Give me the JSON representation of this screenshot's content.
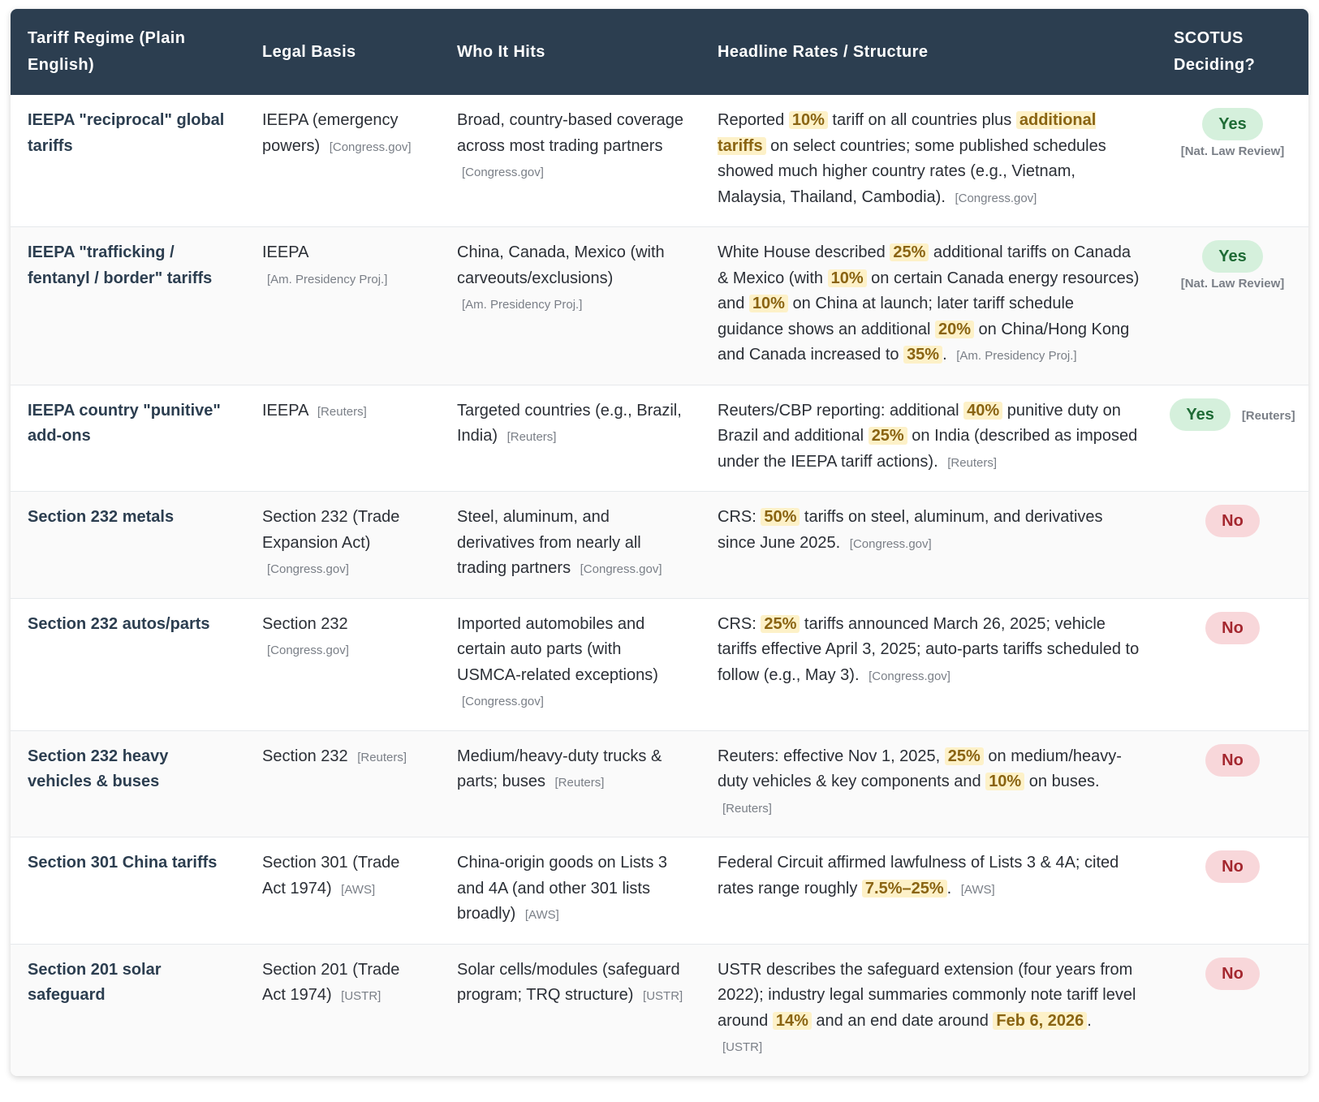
{
  "table": {
    "headers": [
      "Tariff Regime (Plain English)",
      "Legal Basis",
      "Who It Hits",
      "Headline Rates / Structure",
      "SCOTUS Deciding?"
    ],
    "rows": [
      {
        "regime": "IEEPA \"reciprocal\" global tariffs",
        "basis": "IEEPA (emergency powers)",
        "basis_cite": "[Congress.gov]",
        "hits": "Broad, country-based coverage across most trading partners",
        "hits_cite": "[Congress.gov]",
        "rates": [
          {
            "t": "Reported "
          },
          {
            "h": "10%"
          },
          {
            "t": " tariff on all countries plus "
          },
          {
            "h": "additional tariffs"
          },
          {
            "t": " on select countries; some published schedules showed much higher country rates (e.g., Vietnam, Malaysia, Thailand, Cambodia)."
          }
        ],
        "rates_cite": "[Congress.gov]",
        "scotus": "Yes",
        "scotus_cite": "[Nat. Law Review]"
      },
      {
        "regime": "IEEPA \"trafficking / fentanyl / border\" tariffs",
        "basis": "IEEPA",
        "basis_cite": "[Am. Presidency Proj.]",
        "hits": "China, Canada, Mexico (with carveouts/exclusions)",
        "hits_cite": "[Am. Presidency Proj.]",
        "rates": [
          {
            "t": "White House described "
          },
          {
            "h": "25%"
          },
          {
            "t": " additional tariffs on Canada & Mexico (with "
          },
          {
            "h": "10%"
          },
          {
            "t": " on certain Canada energy resources) and "
          },
          {
            "h": "10%"
          },
          {
            "t": " on China at launch; later tariff schedule guidance shows an additional "
          },
          {
            "h": "20%"
          },
          {
            "t": " on China/Hong Kong and Canada increased to "
          },
          {
            "h": "35%"
          },
          {
            "t": "."
          }
        ],
        "rates_cite": "[Am. Presidency Proj.]",
        "scotus": "Yes",
        "scotus_cite": "[Nat. Law Review]"
      },
      {
        "regime": "IEEPA country \"punitive\" add-ons",
        "basis": "IEEPA",
        "basis_cite": "[Reuters]",
        "hits": "Targeted countries (e.g., Brazil, India)",
        "hits_cite": "[Reuters]",
        "rates": [
          {
            "t": "Reuters/CBP reporting: additional "
          },
          {
            "h": "40%"
          },
          {
            "t": " punitive duty on Brazil and additional "
          },
          {
            "h": "25%"
          },
          {
            "t": " on India (described as imposed under the IEEPA tariff actions)."
          }
        ],
        "rates_cite": "[Reuters]",
        "scotus": "Yes",
        "scotus_cite": "[Reuters]",
        "scotus_inline": true
      },
      {
        "regime": "Section 232 metals",
        "basis": "Section 232 (Trade Expansion Act)",
        "basis_cite": "[Congress.gov]",
        "hits": "Steel, aluminum, and derivatives from nearly all trading partners",
        "hits_cite": "[Congress.gov]",
        "rates": [
          {
            "t": "CRS: "
          },
          {
            "h": "50%"
          },
          {
            "t": " tariffs on steel, aluminum, and derivatives since June 2025."
          }
        ],
        "rates_cite": "[Congress.gov]",
        "scotus": "No",
        "scotus_cite": ""
      },
      {
        "regime": "Section 232 autos/parts",
        "basis": "Section 232",
        "basis_cite": "[Congress.gov]",
        "hits": "Imported automobiles and certain auto parts (with USMCA-related exceptions)",
        "hits_cite": "[Congress.gov]",
        "rates": [
          {
            "t": "CRS: "
          },
          {
            "h": "25%"
          },
          {
            "t": " tariffs announced March 26, 2025; vehicle tariffs effective April 3, 2025; auto-parts tariffs scheduled to follow (e.g., May 3)."
          }
        ],
        "rates_cite": "[Congress.gov]",
        "scotus": "No",
        "scotus_cite": ""
      },
      {
        "regime": "Section 232 heavy vehicles & buses",
        "basis": "Section 232",
        "basis_cite": "[Reuters]",
        "hits": "Medium/heavy-duty trucks & parts; buses",
        "hits_cite": "[Reuters]",
        "rates": [
          {
            "t": "Reuters: effective Nov 1, 2025, "
          },
          {
            "h": "25%"
          },
          {
            "t": " on medium/heavy-duty vehicles & key components and "
          },
          {
            "h": "10%"
          },
          {
            "t": " on buses."
          }
        ],
        "rates_cite": "[Reuters]",
        "scotus": "No",
        "scotus_cite": ""
      },
      {
        "regime": "Section 301 China tariffs",
        "basis": "Section 301 (Trade Act 1974)",
        "basis_cite": "[AWS]",
        "hits": "China-origin goods on Lists 3 and 4A (and other 301 lists broadly)",
        "hits_cite": "[AWS]",
        "rates": [
          {
            "t": "Federal Circuit affirmed lawfulness of Lists 3 & 4A; cited rates range roughly "
          },
          {
            "h": "7.5%–25%"
          },
          {
            "t": "."
          }
        ],
        "rates_cite": "[AWS]",
        "scotus": "No",
        "scotus_cite": ""
      },
      {
        "regime": "Section 201 solar safeguard",
        "basis": "Section 201 (Trade Act 1974)",
        "basis_cite": "[USTR]",
        "hits": "Solar cells/modules (safeguard program; TRQ structure)",
        "hits_cite": "[USTR]",
        "rates": [
          {
            "t": "USTR describes the safeguard extension (four years from 2022); industry legal summaries commonly note tariff level around "
          },
          {
            "h": "14%"
          },
          {
            "t": " and an end date around "
          },
          {
            "h": "Feb 6, 2026"
          },
          {
            "t": "."
          }
        ],
        "rates_cite": "[USTR]",
        "scotus": "No",
        "scotus_cite": ""
      }
    ]
  }
}
